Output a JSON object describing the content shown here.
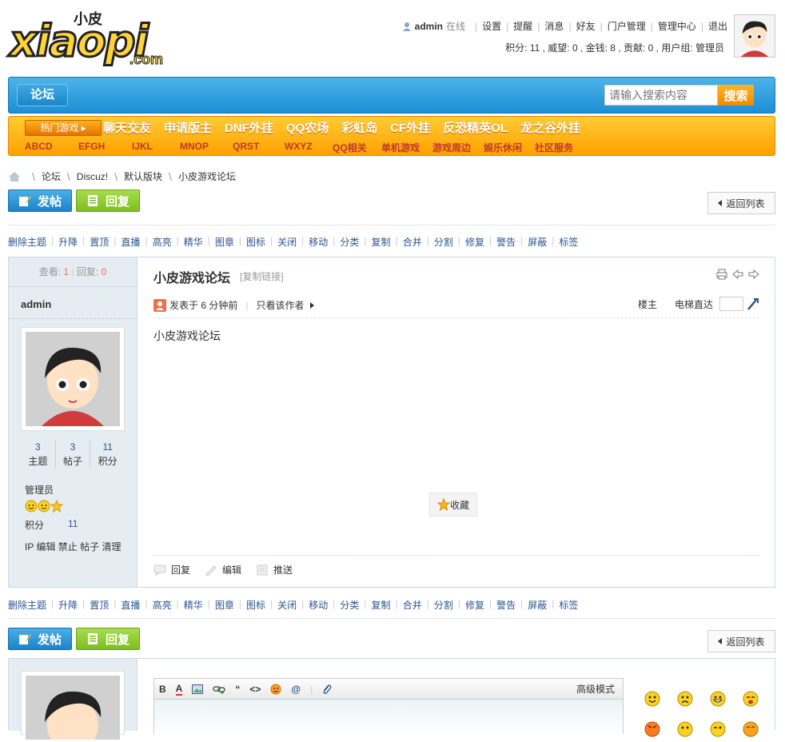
{
  "logo": {
    "small": "小皮",
    "big": "xiaopi",
    "dotcom": ".com"
  },
  "user": {
    "name": "admin",
    "status": "在线",
    "links": [
      "设置",
      "提醒",
      "消息",
      "好友",
      "门户管理",
      "管理中心",
      "退出"
    ],
    "stats": "积分: 11 , 威望: 0 , 金钱: 8 , 贡献: 0 , 用户组:  管理员"
  },
  "nav": {
    "forum": "论坛",
    "search_placeholder": "请输入搜索内容",
    "search_button": "搜索"
  },
  "hot": {
    "label": "热门游戏",
    "row1": [
      "聊天交友",
      "申请版主",
      "DNF外挂",
      "QQ农场",
      "彩虹岛",
      "CF外挂",
      "反恐精英OL",
      "龙之谷外挂"
    ],
    "row2": [
      "ABCD",
      "EFGH",
      "IJKL",
      "MNOP",
      "QRST",
      "WXYZ",
      "QQ相关",
      "单机游戏",
      "游戏周边",
      "娱乐休闲",
      "社区服务"
    ]
  },
  "breadcrumb": [
    "论坛",
    "Discuz!",
    "默认版块",
    "小皮游戏论坛"
  ],
  "buttons": {
    "post": "发帖",
    "reply": "回复",
    "back": "返回列表"
  },
  "mod_actions": [
    "删除主题",
    "升降",
    "置顶",
    "直播",
    "高亮",
    "精华",
    "图章",
    "图标",
    "关闭",
    "移动",
    "分类",
    "复制",
    "合并",
    "分割",
    "修复",
    "警告",
    "屏蔽",
    "标签"
  ],
  "post": {
    "views_label": "查看:",
    "views": "1",
    "replies_label": "回复:",
    "replies": "0",
    "author": "admin",
    "counts": [
      {
        "value": "3",
        "label": "主题"
      },
      {
        "value": "3",
        "label": "帖子"
      },
      {
        "value": "11",
        "label": "积分"
      }
    ],
    "group": "管理员",
    "credit_label": "积分",
    "credit_value": "11",
    "admin_links": "IP 编辑 禁止 帖子 清理",
    "title": "小皮游戏论坛",
    "copy_link": "[复制链接]",
    "posted": "发表于 6 分钟前",
    "only_author": "只看该作者",
    "floor_label": "楼主",
    "jump_label": "电梯直达",
    "content": "小皮游戏论坛",
    "favorite": "收藏",
    "actions": [
      "回复",
      "编辑",
      "推送"
    ]
  },
  "editor": {
    "toolbar": [
      "B",
      "A",
      "img",
      "link",
      "“",
      "<>",
      "☺",
      "@",
      "clip"
    ],
    "advanced": "高级模式"
  },
  "colors": {
    "nav_blue": "#1c8fd4",
    "hot_orange": "#ffa000",
    "link_blue": "#2b5592",
    "count_red": "#f26c4f"
  }
}
